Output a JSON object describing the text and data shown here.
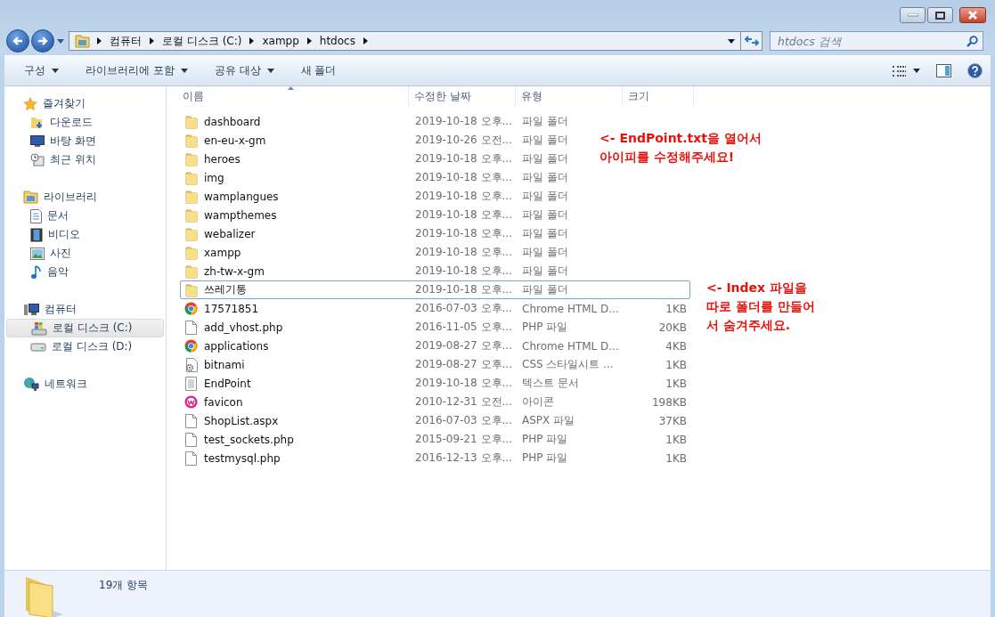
{
  "address": {
    "path": [
      "컴퓨터",
      "로컬 디스크 (C:)",
      "xampp",
      "htdocs"
    ]
  },
  "search": {
    "placeholder": "htdocs 검색"
  },
  "toolbar": {
    "items": [
      {
        "label": "구성",
        "dropdown": true
      },
      {
        "label": "라이브러리에 포함",
        "dropdown": true
      },
      {
        "label": "공유 대상",
        "dropdown": true
      },
      {
        "label": "새 폴더",
        "dropdown": false
      }
    ]
  },
  "sidebar": {
    "groups": [
      {
        "label": "즐겨찾기",
        "kind": "star",
        "selected": false,
        "children": [
          {
            "label": "다운로드",
            "kind": "download",
            "selected": false
          },
          {
            "label": "바탕 화면",
            "kind": "desktop",
            "selected": false
          },
          {
            "label": "최근 위치",
            "kind": "recent",
            "selected": false
          }
        ]
      },
      {
        "label": "라이브러리",
        "kind": "library",
        "selected": false,
        "children": [
          {
            "label": "문서",
            "kind": "document",
            "selected": false
          },
          {
            "label": "비디오",
            "kind": "video",
            "selected": false
          },
          {
            "label": "사진",
            "kind": "picture",
            "selected": false
          },
          {
            "label": "음악",
            "kind": "music",
            "selected": false
          }
        ]
      },
      {
        "label": "컴퓨터",
        "kind": "computer",
        "selected": false,
        "children": [
          {
            "label": "로컬 디스크 (C:)",
            "kind": "system-drive",
            "selected": true
          },
          {
            "label": "로컬 디스크 (D:)",
            "kind": "drive",
            "selected": false
          }
        ]
      },
      {
        "label": "네트워크",
        "kind": "network",
        "selected": false
      }
    ]
  },
  "table": {
    "columns": [
      {
        "label": "이름",
        "sorted": true
      },
      {
        "label": "수정한 날짜",
        "sorted": false
      },
      {
        "label": "유형",
        "sorted": false
      },
      {
        "label": "크기",
        "sorted": false
      }
    ],
    "rows": [
      {
        "name": "dashboard",
        "date": "2019-10-18 오후...",
        "type": "파일 폴더",
        "kind": "folder",
        "focused": false
      },
      {
        "name": "en-eu-x-gm",
        "date": "2019-10-26 오전...",
        "type": "파일 폴더",
        "kind": "folder",
        "focused": false
      },
      {
        "name": "heroes",
        "date": "2019-10-18 오후...",
        "type": "파일 폴더",
        "kind": "folder",
        "focused": false
      },
      {
        "name": "img",
        "date": "2019-10-18 오후...",
        "type": "파일 폴더",
        "kind": "folder",
        "focused": false
      },
      {
        "name": "wamplangues",
        "date": "2019-10-18 오후...",
        "type": "파일 폴더",
        "kind": "folder",
        "focused": false
      },
      {
        "name": "wampthemes",
        "date": "2019-10-18 오후...",
        "type": "파일 폴더",
        "kind": "folder",
        "focused": false
      },
      {
        "name": "webalizer",
        "date": "2019-10-18 오후...",
        "type": "파일 폴더",
        "kind": "folder",
        "focused": false
      },
      {
        "name": "xampp",
        "date": "2019-10-18 오후...",
        "type": "파일 폴더",
        "kind": "folder",
        "focused": false
      },
      {
        "name": "zh-tw-x-gm",
        "date": "2019-10-18 오후...",
        "type": "파일 폴더",
        "kind": "folder",
        "focused": false
      },
      {
        "name": "쓰레기통",
        "date": "2019-10-18 오후...",
        "type": "파일 폴더",
        "kind": "folder",
        "focused": true
      },
      {
        "name": "17571851",
        "date": "2016-07-03 오후...",
        "type": "Chrome HTML D...",
        "size": "1KB",
        "kind": "chrome",
        "focused": false
      },
      {
        "name": "add_vhost.php",
        "date": "2016-11-05 오후...",
        "type": "PHP 파일",
        "size": "20KB",
        "kind": "file",
        "focused": false
      },
      {
        "name": "applications",
        "date": "2019-08-27 오후...",
        "type": "Chrome HTML D...",
        "size": "4KB",
        "kind": "chrome",
        "focused": false
      },
      {
        "name": "bitnami",
        "date": "2019-08-27 오후...",
        "type": "CSS 스타일시트 ...",
        "size": "1KB",
        "kind": "stylesheet",
        "focused": false
      },
      {
        "name": "EndPoint",
        "date": "2019-10-18 오후...",
        "type": "텍스트 문서",
        "size": "1KB",
        "kind": "text",
        "focused": false
      },
      {
        "name": "favicon",
        "date": "2010-12-31 오전...",
        "type": "아이콘",
        "size": "198KB",
        "kind": "wamp",
        "focused": false
      },
      {
        "name": "ShopList.aspx",
        "date": "2016-07-03 오후...",
        "type": "ASPX 파일",
        "size": "37KB",
        "kind": "file",
        "focused": false
      },
      {
        "name": "test_sockets.php",
        "date": "2015-09-21 오후...",
        "type": "PHP 파일",
        "size": "1KB",
        "kind": "file",
        "focused": false
      },
      {
        "name": "testmysql.php",
        "date": "2016-12-13 오후...",
        "type": "PHP 파일",
        "size": "1KB",
        "kind": "file",
        "focused": false
      }
    ]
  },
  "notes": [
    {
      "text": "<- EndPoint.txt을 열어서\n아이피를 수정해주세요!"
    },
    {
      "text": "<- Index 파일을\n따로 폴더를 만들어\n서 숨겨주세요."
    }
  ],
  "status_bar": {
    "text": "19개 항목"
  }
}
